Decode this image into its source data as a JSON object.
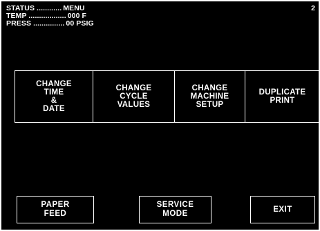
{
  "status": {
    "rows": [
      {
        "label": "STATUS ............",
        "value": "MENU"
      },
      {
        "label": "TEMP ..................",
        "value": "000 F"
      },
      {
        "label": "PRESS ...............",
        "value": "00 PSIG"
      }
    ],
    "screen_number": "2"
  },
  "actions": [
    {
      "label": "CHANGE\nTIME\n&\nDATE"
    },
    {
      "label": "CHANGE\nCYCLE\nVALUES"
    },
    {
      "label": "CHANGE\nMACHINE\nSETUP"
    },
    {
      "label": "DUPLICATE\nPRINT"
    }
  ],
  "bottom": {
    "paper_feed": "PAPER\nFEED",
    "service_mode": "SERVICE\nMODE",
    "exit": "EXIT"
  },
  "colors": {
    "background": "#000000",
    "foreground": "#ffffff"
  }
}
